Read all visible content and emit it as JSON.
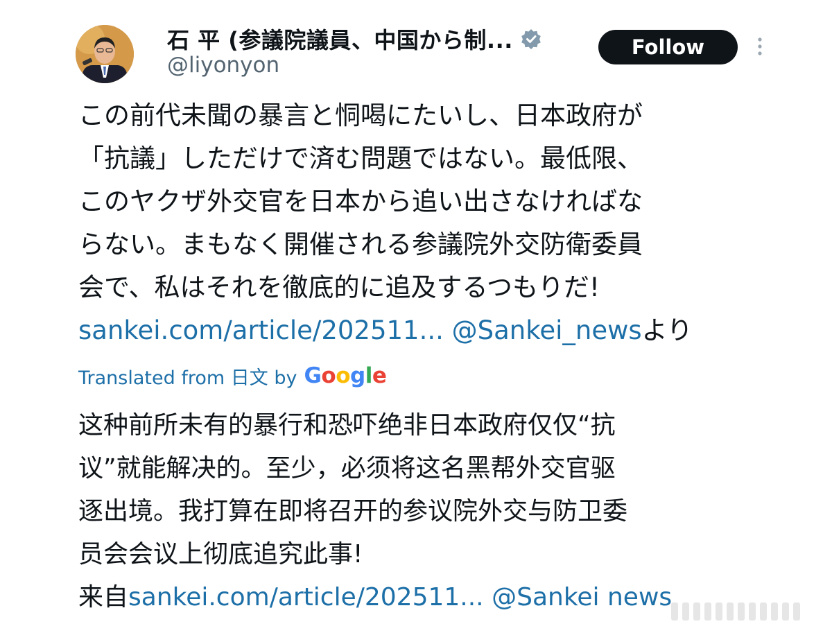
{
  "author": {
    "display_name": "石 平 (参議院議員、中国から制...",
    "handle": "@liyonyon",
    "verified_icon": "verified-badge-icon"
  },
  "header": {
    "follow_label": "Follow",
    "more_icon": "more-vertical-icon"
  },
  "tweet": {
    "jp_lines": [
      "この前代未聞の暴言と恫喝にたいし、日本政府が",
      "「抗議」しただけで済む問題ではない。最低限、",
      "このヤクザ外交官を日本から追い出さなければな",
      "らない。まもなく開催される参議院外交防衛委員",
      "会で、私はそれを徹底的に追及するつもりだ!"
    ],
    "jp_link": "sankei.com/article/202511...",
    "jp_mention": "@Sankei_news",
    "jp_suffix": "より"
  },
  "translation": {
    "label": "Translated from 日文 by",
    "provider": "Google"
  },
  "translated_text": {
    "lines": [
      "这种前所未有的暴行和恐吓绝非日本政府仅仅“抗",
      "议”就能解决的。至少，必须将这名黑帮外交官驱",
      "逐出境。我打算在即将召开的参议院外交与防卫委",
      "员会会议上彻底追究此事!"
    ],
    "prefix": "来自",
    "link": "sankei.com/article/202511...",
    "mention": "@Sankei news"
  },
  "colors": {
    "link": "#1d6fa8",
    "text": "#0f1419",
    "secondary": "#536471",
    "follow_bg": "#0f1419",
    "verified": "#829aab"
  }
}
